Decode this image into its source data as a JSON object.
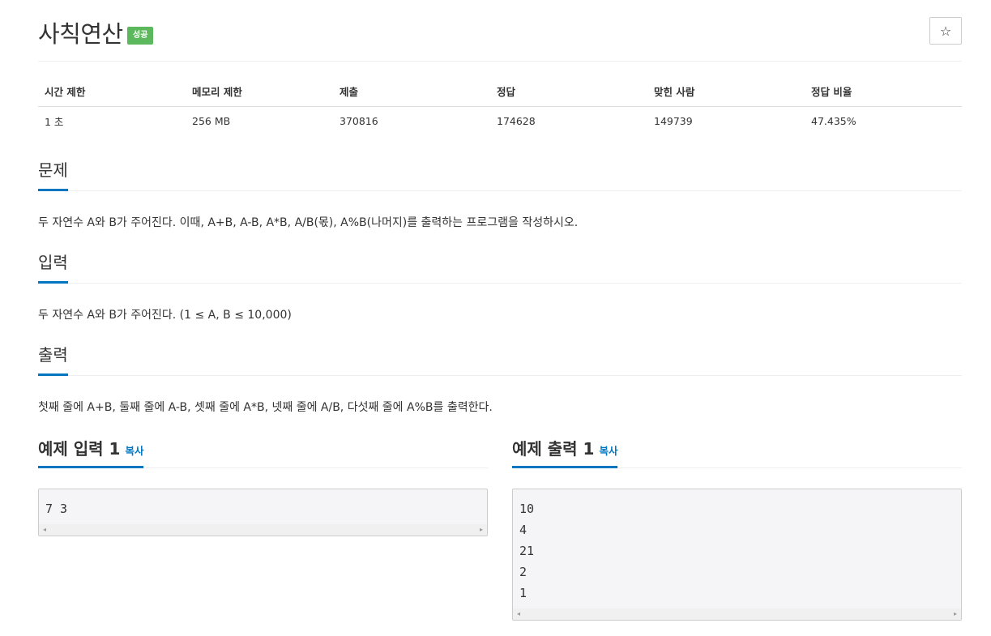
{
  "header": {
    "title": "사칙연산",
    "badge": "성공",
    "star": "☆"
  },
  "info": {
    "headers": [
      "시간 제한",
      "메모리 제한",
      "제출",
      "정답",
      "맞힌 사람",
      "정답 비율"
    ],
    "values": [
      "1 초",
      "256 MB",
      "370816",
      "174628",
      "149739",
      "47.435%"
    ]
  },
  "problem": {
    "title": "문제",
    "body": "두 자연수 A와 B가 주어진다. 이때, A+B, A-B, A*B, A/B(몫), A%B(나머지)를 출력하는 프로그램을 작성하시오."
  },
  "input": {
    "title": "입력",
    "body": "두 자연수 A와 B가 주어진다. (1 ≤ A, B ≤ 10,000)"
  },
  "output": {
    "title": "출력",
    "body": "첫째 줄에 A+B, 둘째 줄에 A-B, 셋째 줄에 A*B, 넷째 줄에 A/B, 다섯째 줄에 A%B를 출력한다."
  },
  "sample_input": {
    "title": "예제 입력 1",
    "copy": "복사",
    "text": "7 3"
  },
  "sample_output": {
    "title": "예제 출력 1",
    "copy": "복사",
    "text": "10\n4\n21\n2\n1"
  },
  "colors": {
    "accent": "#0076c0",
    "success": "#5cb85c",
    "sample_bg": "#f5f5f7"
  }
}
